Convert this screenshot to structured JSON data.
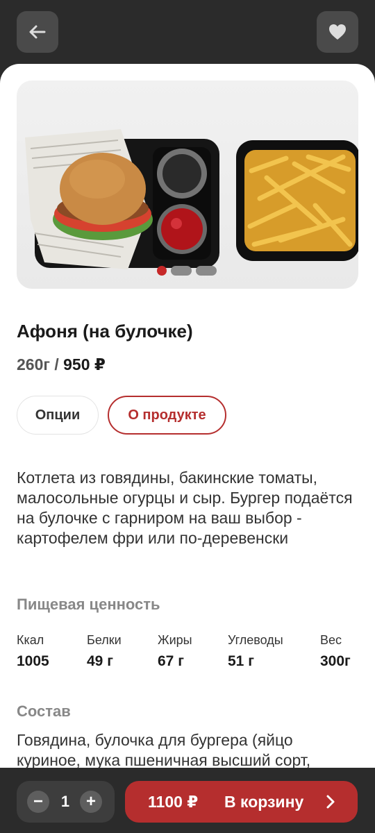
{
  "header": {
    "back_icon": "arrow-left-icon",
    "favorite_icon": "heart-icon"
  },
  "gallery": {
    "image": "burger-with-fries-photo",
    "slide_count": 3,
    "active_slide": 1,
    "active_color": "#c62828"
  },
  "product": {
    "name": "Афоня (на булочке)",
    "weight": "260г /",
    "price": "950 ₽",
    "tabs": [
      {
        "label": "Опции",
        "active": false
      },
      {
        "label": "О продукте",
        "active": true
      }
    ],
    "description": "Котлета из говядины, бакинские томаты, малосольные огурцы и сыр. Бургер подаётся на булочке с гарниром на ваш выбор - картофелем фри или по-деревенски"
  },
  "nutrition": {
    "title": "Пищевая ценность",
    "items": [
      {
        "label": "Ккал",
        "value": "1005"
      },
      {
        "label": "Белки",
        "value": "49 г"
      },
      {
        "label": "Жиры",
        "value": "67 г"
      },
      {
        "label": "Углеводы",
        "value": "51 г"
      },
      {
        "label": "Вес",
        "value": "300г"
      }
    ]
  },
  "composition": {
    "title": "Состав",
    "text": "Говядина, булочка для бургера (яйцо куриное, мука пшеничная высший сорт,"
  },
  "bottom_bar": {
    "minus": "−",
    "quantity": "1",
    "plus": "+",
    "cart_price": "1100 ₽",
    "cart_label": "В корзину",
    "accent": "#b52e2e"
  }
}
